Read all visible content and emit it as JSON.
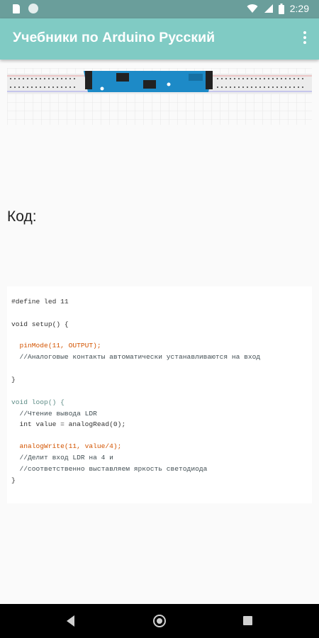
{
  "status_bar": {
    "time": "2:29",
    "icons": [
      "sd-card-icon",
      "circle-notification-icon",
      "wifi-icon",
      "signal-icon",
      "battery-icon"
    ]
  },
  "app_bar": {
    "title": "Учебники по Arduino Русский",
    "menu_icon": "overflow-menu-icon"
  },
  "content": {
    "heading": "Код:",
    "code_lines": [
      "#define led 11",
      "",
      "void setup() {",
      "",
      "  pinMode(11, OUTPUT);",
      "  //Аналоговые контакты автоматически устанавливаются на вход",
      "",
      "}",
      "",
      "void loop() {",
      "  //Чтение вывода LDR",
      "  int value = analogRead(0);",
      "",
      "  analogWrite(11, value/4);",
      "  //Делит вход LDR на 4 и",
      "  //соответственно выставляем яркость светодиода",
      "}"
    ]
  },
  "colors": {
    "status_bar": "#6a9e9b",
    "app_bar": "#80cbc4",
    "nav_bar": "#000000"
  }
}
